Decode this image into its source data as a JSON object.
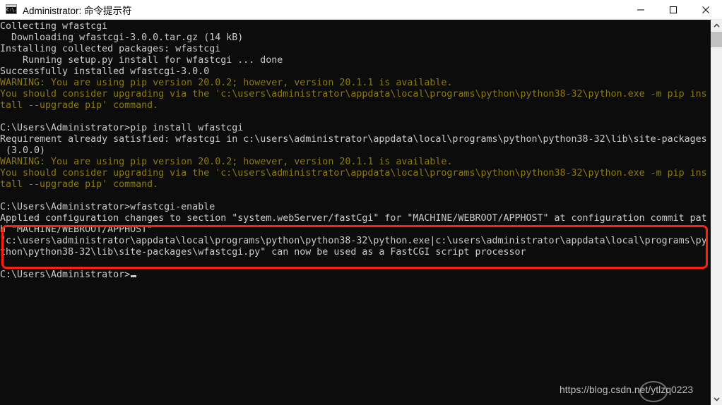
{
  "window": {
    "title": "Administrator: 命令提示符",
    "icon": "console-icon",
    "minimize_label": "—",
    "maximize_label": "□",
    "close_label": "✕"
  },
  "terminal": {
    "background_color": "#0c0c0c",
    "text_color": "#cccccc",
    "warning_color": "#8a7a12",
    "lines": [
      {
        "text": "Collecting wfastcgi",
        "style": "normal"
      },
      {
        "text": "  Downloading wfastcgi-3.0.0.tar.gz (14 kB)",
        "style": "normal"
      },
      {
        "text": "Installing collected packages: wfastcgi",
        "style": "normal"
      },
      {
        "text": "    Running setup.py install for wfastcgi ... done",
        "style": "normal"
      },
      {
        "text": "Successfully installed wfastcgi-3.0.0",
        "style": "normal"
      },
      {
        "text": "WARNING: You are using pip version 20.0.2; however, version 20.1.1 is available.",
        "style": "warning"
      },
      {
        "text": "You should consider upgrading via the 'c:\\users\\administrator\\appdata\\local\\programs\\python\\python38-32\\python.exe -m pip ins",
        "style": "warning"
      },
      {
        "text": "tall --upgrade pip' command.",
        "style": "warning"
      },
      {
        "text": "",
        "style": "blank"
      },
      {
        "text": "C:\\Users\\Administrator>pip install wfastcgi",
        "style": "normal"
      },
      {
        "text": "Requirement already satisfied: wfastcgi in c:\\users\\administrator\\appdata\\local\\programs\\python\\python38-32\\lib\\site-packages",
        "style": "normal"
      },
      {
        "text": " (3.0.0)",
        "style": "normal"
      },
      {
        "text": "WARNING: You are using pip version 20.0.2; however, version 20.1.1 is available.",
        "style": "warning"
      },
      {
        "text": "You should consider upgrading via the 'c:\\users\\administrator\\appdata\\local\\programs\\python\\python38-32\\python.exe -m pip ins",
        "style": "warning"
      },
      {
        "text": "tall --upgrade pip' command.",
        "style": "warning"
      },
      {
        "text": "",
        "style": "blank"
      },
      {
        "text": "C:\\Users\\Administrator>wfastcgi-enable",
        "style": "normal"
      },
      {
        "text": "Applied configuration changes to section \"system.webServer/fastCgi\" for \"MACHINE/WEBROOT/APPHOST\" at configuration commit pat",
        "style": "normal"
      },
      {
        "text": "h \"MACHINE/WEBROOT/APPHOST\"",
        "style": "normal"
      },
      {
        "text": "\"c:\\users\\administrator\\appdata\\local\\programs\\python\\python38-32\\python.exe|c:\\users\\administrator\\appdata\\local\\programs\\py",
        "style": "normal"
      },
      {
        "text": "thon\\python38-32\\lib\\site-packages\\wfastcgi.py\" can now be used as a FastCGI script processor",
        "style": "normal"
      },
      {
        "text": "",
        "style": "blank"
      },
      {
        "text": "C:\\Users\\Administrator>",
        "style": "normal"
      }
    ],
    "cursor": "block-cursor"
  },
  "annotation": {
    "type": "red-rectangle-highlight",
    "color": "#fb2210"
  },
  "scrollbar": {
    "up_arrow": "▲",
    "down_arrow": "▼",
    "thumb": "scroll-thumb"
  },
  "watermark": {
    "text": "https://blog.csdn.net/ytlzq0223"
  }
}
